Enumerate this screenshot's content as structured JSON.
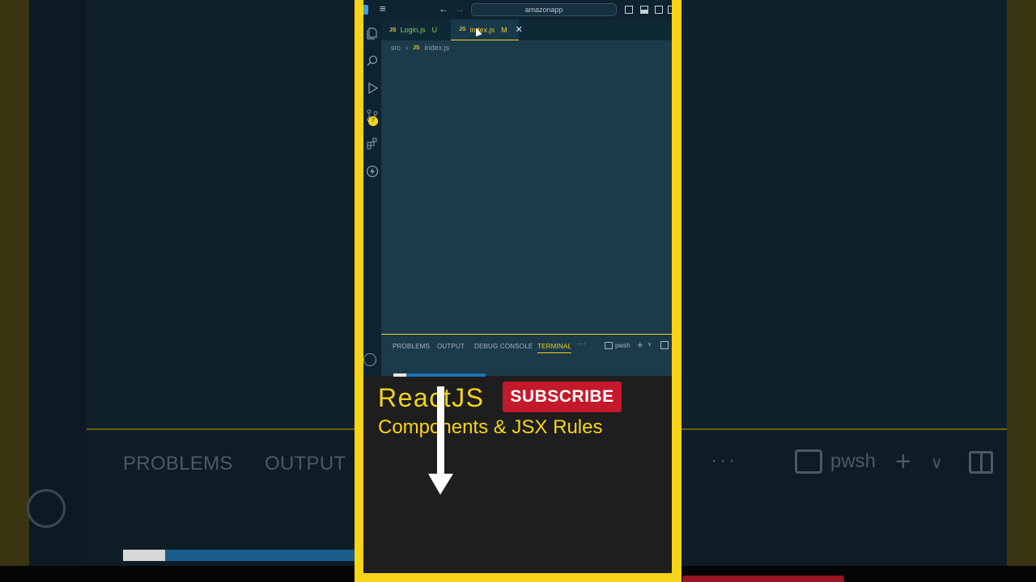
{
  "background": {
    "panel_tabs": [
      "PROBLEMS",
      "OUTPUT"
    ],
    "dots": "···",
    "terminal_name": "pwsh",
    "plus": "+",
    "chevron": "∨"
  },
  "vscode": {
    "search_text": "amazonapp",
    "menu_glyph": "≡",
    "back_glyph": "←",
    "forward_glyph": "→",
    "tabs": [
      {
        "js": "JS",
        "name": "Login.js",
        "mark": "U"
      },
      {
        "js": "JS",
        "name": "index.js",
        "mark": "M",
        "close": "✕"
      }
    ],
    "breadcrumb": {
      "folder": "src",
      "sep": "›",
      "js": "JS",
      "file": "index.js"
    },
    "activity_badge": "7",
    "panel": {
      "tabs": [
        "PROBLEMS",
        "OUTPUT",
        "DEBUG CONSOLE",
        "TERMINAL"
      ],
      "active_tab": "TERMINAL",
      "dots": "···",
      "terminal_name": "pwsh",
      "plus": "+",
      "chevron": "∨"
    }
  },
  "overlay": {
    "title": "ReactJS",
    "subscribe_label": "SUBSCRIBE",
    "subtitle": "Components & JSX Rules"
  },
  "colors": {
    "frame": "#f7d417",
    "subscribe": "#c4192b",
    "editor_bg": "#1b3a4a",
    "text_accent": "#f7d417"
  },
  "icons": [
    "explorer-icon",
    "search-icon",
    "run-debug-icon",
    "source-control-icon",
    "extensions-icon",
    "lightning-icon",
    "account-icon",
    "terminal-icon",
    "split-icon",
    "arrow-down-icon"
  ]
}
